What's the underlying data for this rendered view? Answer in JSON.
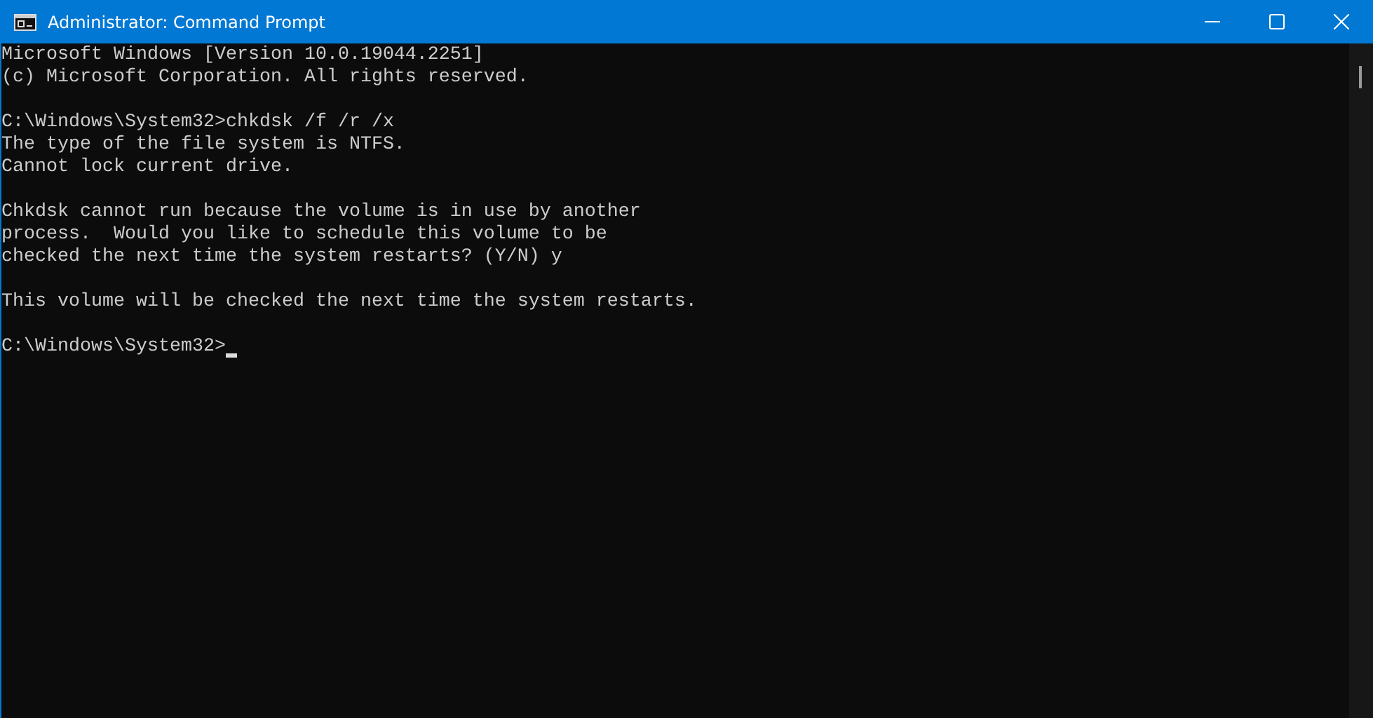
{
  "window": {
    "title": "Administrator: Command Prompt"
  },
  "console": {
    "blocks": [
      [
        "Microsoft Windows [Version 10.0.19044.2251]",
        "(c) Microsoft Corporation. All rights reserved."
      ],
      [
        "C:\\Windows\\System32>chkdsk /f /r /x",
        "The type of the file system is NTFS.",
        "Cannot lock current drive."
      ],
      [
        "Chkdsk cannot run because the volume is in use by another",
        "process.  Would you like to schedule this volume to be",
        "checked the next time the system restarts? (Y/N) y"
      ],
      [
        "This volume will be checked the next time the system restarts."
      ]
    ],
    "prompt": {
      "text": "C:\\Windows\\System32>",
      "cursor": true
    }
  }
}
